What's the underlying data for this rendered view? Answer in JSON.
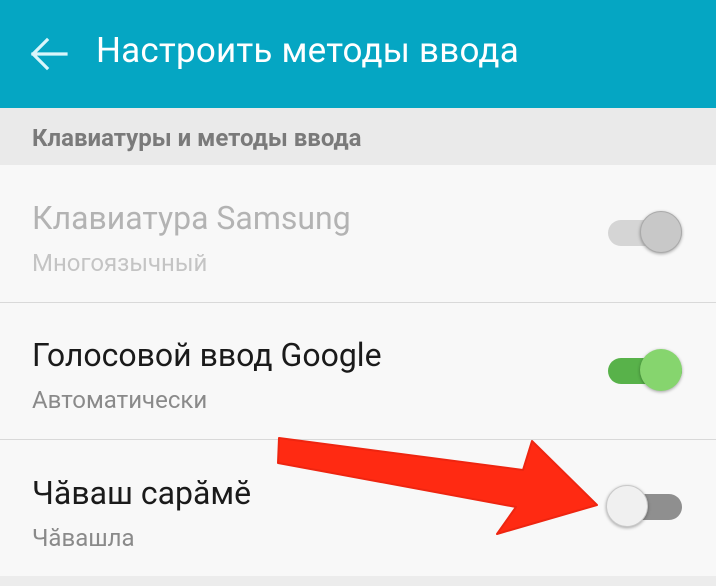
{
  "appbar": {
    "title": "Настроить методы ввода",
    "back_icon": "arrow-left-icon",
    "color": "#05a6c3"
  },
  "section": {
    "label": "Клавиатуры и методы ввода"
  },
  "rows": [
    {
      "title": "Клавиатура Samsung",
      "subtitle": "Многоязычный",
      "switch": "on",
      "enabled": false
    },
    {
      "title": "Голосовой ввод Google",
      "subtitle": "Автоматически",
      "switch": "on",
      "enabled": true
    },
    {
      "title": "Чăваш сарăмĕ",
      "subtitle": "Чăвашла",
      "switch": "off",
      "enabled": true
    }
  ],
  "annotation": {
    "icon": "red-arrow-icon",
    "color": "#ff2a12"
  }
}
